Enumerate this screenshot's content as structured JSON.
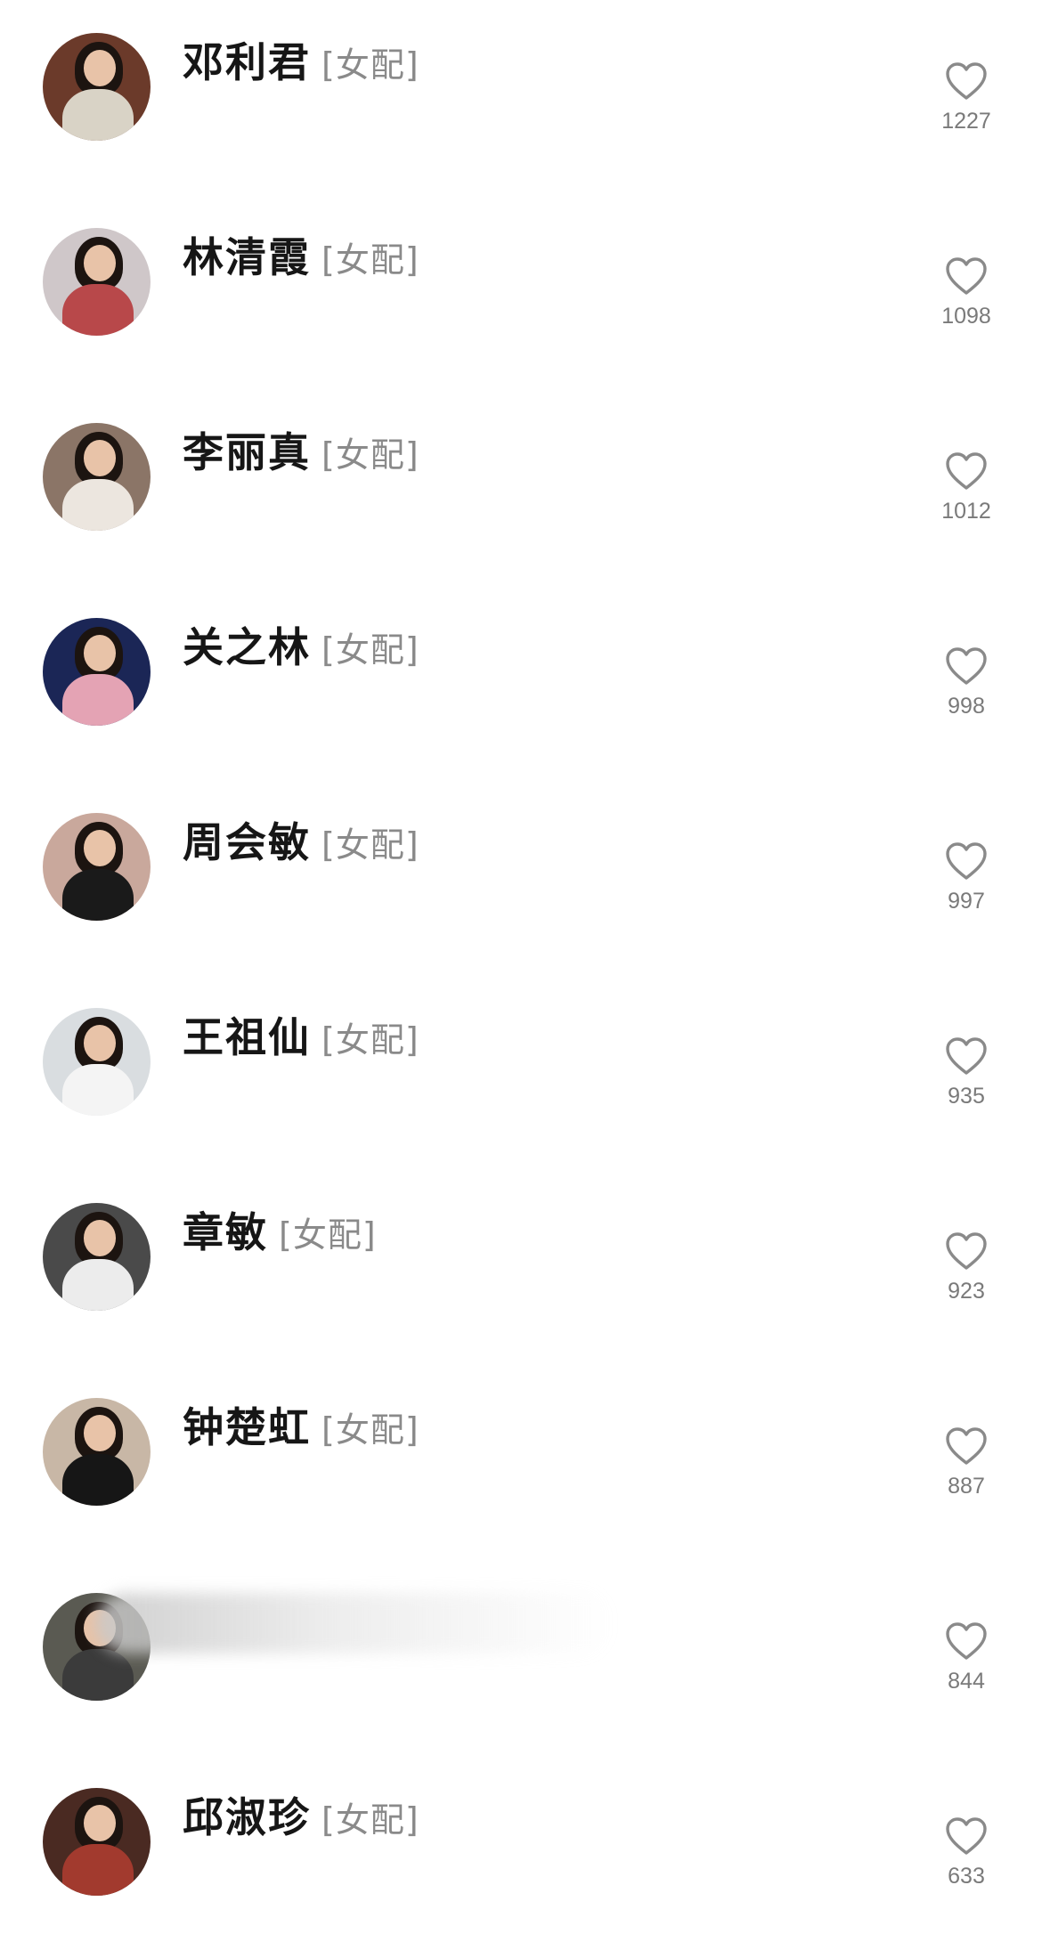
{
  "tag_label": "[女配]",
  "items": [
    {
      "name": "邓利君",
      "tag": "[女配]",
      "likes": "1227",
      "avatar": {
        "bg": "#6b3a2a",
        "accent": "#d9d3c6"
      }
    },
    {
      "name": "林清霞",
      "tag": "[女配]",
      "likes": "1098",
      "avatar": {
        "bg": "#cfc7c9",
        "accent": "#b8484a"
      }
    },
    {
      "name": "李丽真",
      "tag": "[女配]",
      "likes": "1012",
      "avatar": {
        "bg": "#8b7567",
        "accent": "#ece6df"
      }
    },
    {
      "name": "关之林",
      "tag": "[女配]",
      "likes": "998",
      "avatar": {
        "bg": "#1b2656",
        "accent": "#e4a3b4"
      }
    },
    {
      "name": "周会敏",
      "tag": "[女配]",
      "likes": "997",
      "avatar": {
        "bg": "#c9a89c",
        "accent": "#1a1a1a"
      }
    },
    {
      "name": "王祖仙",
      "tag": "[女配]",
      "likes": "935",
      "avatar": {
        "bg": "#d9dde0",
        "accent": "#f4f4f4"
      }
    },
    {
      "name": "章敏",
      "tag": "[女配]",
      "likes": "923",
      "avatar": {
        "bg": "#4a4a4a",
        "accent": "#ececec"
      }
    },
    {
      "name": "钟楚虹",
      "tag": "[女配]",
      "likes": "887",
      "avatar": {
        "bg": "#c8b7a6",
        "accent": "#161616"
      }
    },
    {
      "name": "",
      "tag": "",
      "likes": "844",
      "blurred": true,
      "avatar": {
        "bg": "#5a5a52",
        "accent": "#3b3b3b"
      }
    },
    {
      "name": "邱淑珍",
      "tag": "[女配]",
      "likes": "633",
      "avatar": {
        "bg": "#4a2a22",
        "accent": "#a23a2e"
      }
    }
  ],
  "colors": {
    "name": "#161616",
    "tag": "#8a8a8a",
    "heart": "#8a8a8a",
    "count": "#7a7a7a",
    "background": "#ffffff"
  },
  "icons": {
    "like": "heart-outline-icon"
  }
}
